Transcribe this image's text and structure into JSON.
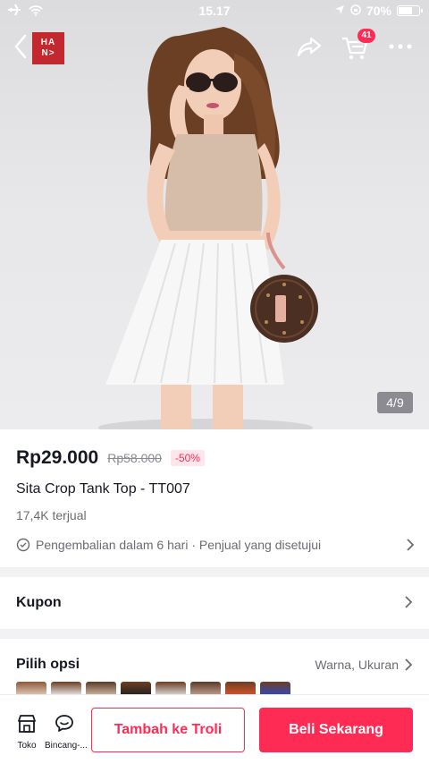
{
  "status_bar": {
    "time": "15.17",
    "battery": "70%",
    "battery_level": 0.7
  },
  "header": {
    "shop_logo_line1": "HA",
    "shop_logo_line2": "N>",
    "cart_count": "41"
  },
  "gallery": {
    "counter": "4/9"
  },
  "product": {
    "price": "Rp29.000",
    "original_price": "Rp58.000",
    "discount": "-50%",
    "name": "Sita Crop Tank Top - TT007",
    "sold": "17,4K terjual",
    "policy": "Pengembalian dalam 6 hari · Penjual yang disetujui"
  },
  "coupon": {
    "title": "Kupon"
  },
  "options": {
    "title": "Pilih opsi",
    "hint": "Warna, Ukuran"
  },
  "bottom_bar": {
    "shop_label": "Toko",
    "chat_label": "Bincang-...",
    "add_to_cart": "Tambah ke Troli",
    "buy_now": "Beli Sekarang"
  },
  "colors": {
    "accent": "#fe2c55",
    "brand": "#c3282e"
  }
}
